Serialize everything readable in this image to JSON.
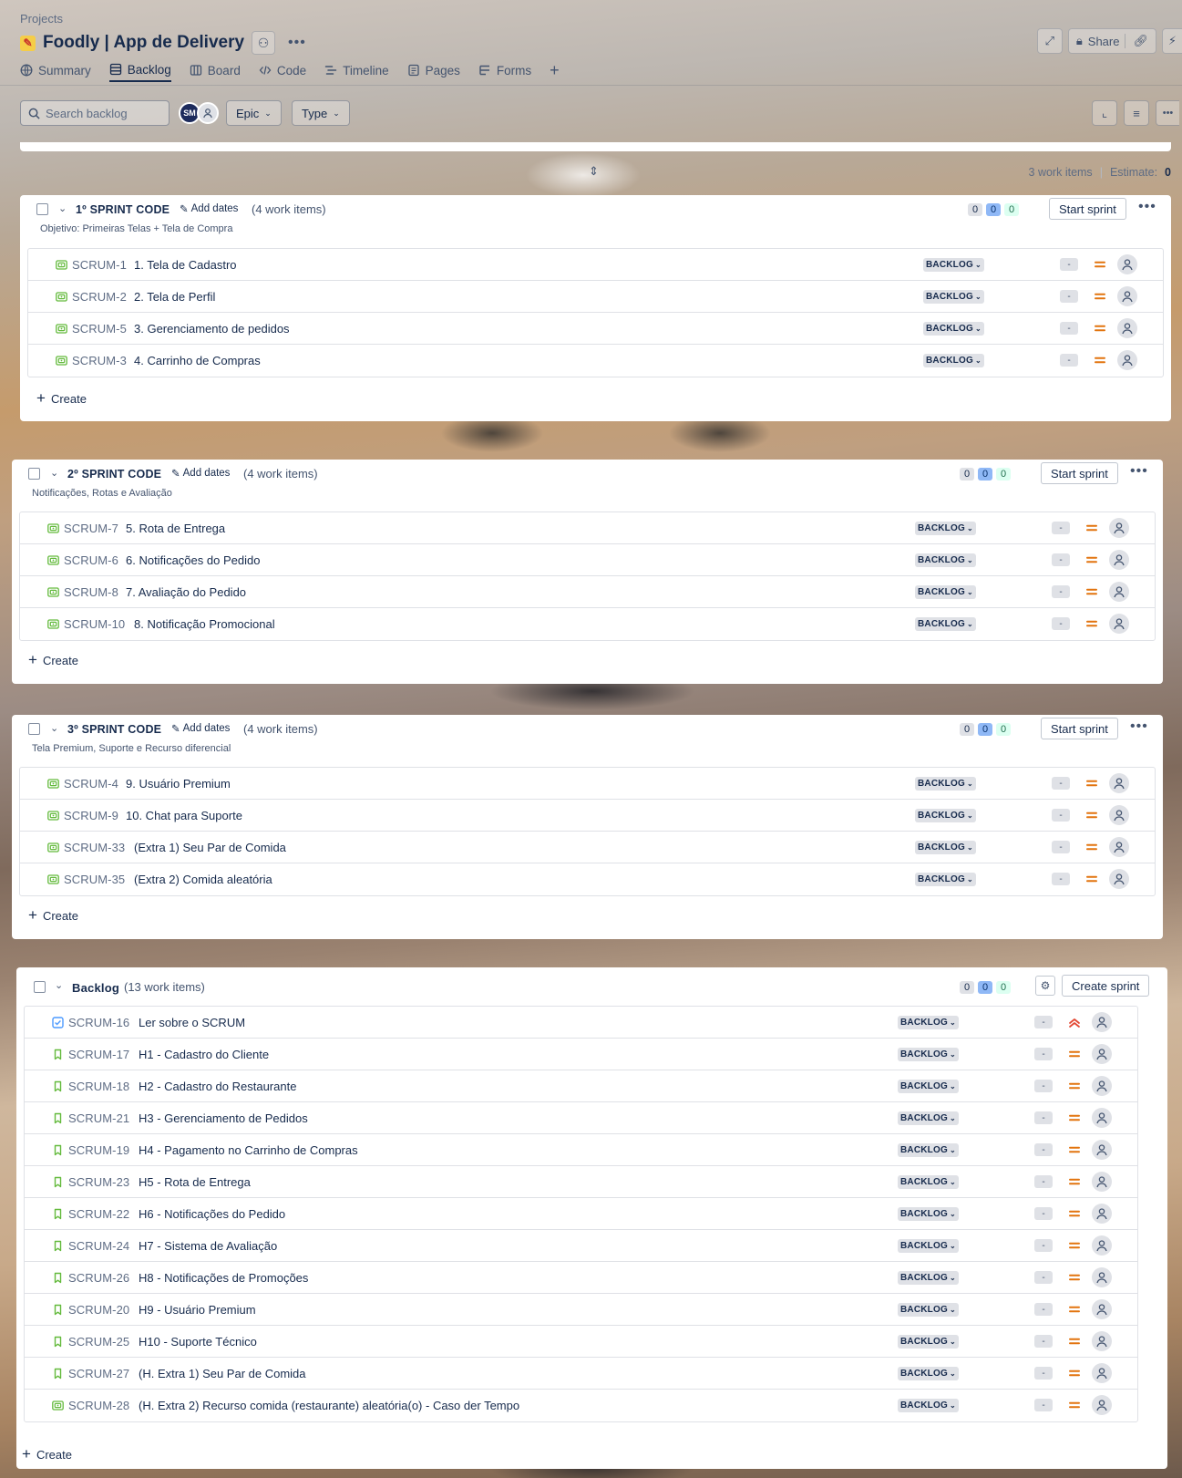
{
  "header": {
    "breadcrumb": "Projects",
    "project_name": "Foodly | App de Delivery",
    "share_label": "Share"
  },
  "tabs": [
    {
      "label": "Summary",
      "icon": "globe-icon"
    },
    {
      "label": "Backlog",
      "icon": "backlog-icon",
      "active": true
    },
    {
      "label": "Board",
      "icon": "board-icon"
    },
    {
      "label": "Code",
      "icon": "code-icon"
    },
    {
      "label": "Timeline",
      "icon": "timeline-icon"
    },
    {
      "label": "Pages",
      "icon": "pages-icon"
    },
    {
      "label": "Forms",
      "icon": "forms-icon"
    }
  ],
  "toolbar": {
    "search_placeholder": "Search backlog",
    "avatar_initials": "SM",
    "epic_label": "Epic",
    "type_label": "Type"
  },
  "top_summary": {
    "work_items": "3 work items",
    "estimate_label": "Estimate:",
    "estimate_value": "0"
  },
  "sprints": [
    {
      "name": "1º SPRINT CODE",
      "add_dates": "Add dates",
      "count_text": "(4 work items)",
      "goal": "Objetivo: Primeiras Telas + Tela de Compra",
      "counts": [
        "0",
        "0",
        "0"
      ],
      "action": "Start sprint",
      "create": "Create",
      "items": [
        {
          "key": "SCRUM-1",
          "summary": "1. Tela de Cadastro",
          "status": "BACKLOG",
          "estimate": "-"
        },
        {
          "key": "SCRUM-2",
          "summary": "2. Tela de Perfil",
          "status": "BACKLOG",
          "estimate": "-"
        },
        {
          "key": "SCRUM-5",
          "summary": "3. Gerenciamento de pedidos",
          "status": "BACKLOG",
          "estimate": "-"
        },
        {
          "key": "SCRUM-3",
          "summary": "4. Carrinho de Compras",
          "status": "BACKLOG",
          "estimate": "-"
        }
      ]
    },
    {
      "name": "2º SPRINT CODE",
      "add_dates": "Add dates",
      "count_text": "(4 work items)",
      "goal": "Notificações, Rotas e Avaliação",
      "counts": [
        "0",
        "0",
        "0"
      ],
      "action": "Start sprint",
      "create": "Create",
      "items": [
        {
          "key": "SCRUM-7",
          "summary": "5. Rota de Entrega",
          "status": "BACKLOG",
          "estimate": "-"
        },
        {
          "key": "SCRUM-6",
          "summary": "6. Notificações do Pedido",
          "status": "BACKLOG",
          "estimate": "-"
        },
        {
          "key": "SCRUM-8",
          "summary": "7. Avaliação do Pedido",
          "status": "BACKLOG",
          "estimate": "-"
        },
        {
          "key": "SCRUM-10",
          "summary": "8. Notificação Promocional",
          "status": "BACKLOG",
          "estimate": "-"
        }
      ]
    },
    {
      "name": "3º SPRINT CODE",
      "add_dates": "Add dates",
      "count_text": "(4 work items)",
      "goal": "Tela Premium, Suporte e Recurso diferencial",
      "counts": [
        "0",
        "0",
        "0"
      ],
      "action": "Start sprint",
      "create": "Create",
      "items": [
        {
          "key": "SCRUM-4",
          "summary": "9. Usuário Premium",
          "status": "BACKLOG",
          "estimate": "-"
        },
        {
          "key": "SCRUM-9",
          "summary": "10. Chat para Suporte",
          "status": "BACKLOG",
          "estimate": "-"
        },
        {
          "key": "SCRUM-33",
          "summary": "(Extra 1) Seu Par de Comida",
          "status": "BACKLOG",
          "estimate": "-"
        },
        {
          "key": "SCRUM-35",
          "summary": "(Extra 2) Comida aleatória",
          "status": "BACKLOG",
          "estimate": "-"
        }
      ]
    }
  ],
  "backlog": {
    "name": "Backlog",
    "count_text": "(13 work items)",
    "counts": [
      "0",
      "0",
      "0"
    ],
    "action": "Create sprint",
    "create": "Create",
    "items": [
      {
        "key": "SCRUM-16",
        "summary": "Ler sobre o SCRUM",
        "status": "BACKLOG",
        "estimate": "-",
        "type": "task",
        "priority": "highest"
      },
      {
        "key": "SCRUM-17",
        "summary": "H1 - Cadastro do Cliente",
        "status": "BACKLOG",
        "estimate": "-",
        "type": "story"
      },
      {
        "key": "SCRUM-18",
        "summary": "H2 - Cadastro do Restaurante",
        "status": "BACKLOG",
        "estimate": "-",
        "type": "story"
      },
      {
        "key": "SCRUM-21",
        "summary": "H3 - Gerenciamento de Pedidos",
        "status": "BACKLOG",
        "estimate": "-",
        "type": "story"
      },
      {
        "key": "SCRUM-19",
        "summary": "H4 - Pagamento no Carrinho de Compras",
        "status": "BACKLOG",
        "estimate": "-",
        "type": "story"
      },
      {
        "key": "SCRUM-23",
        "summary": "H5 - Rota de Entrega",
        "status": "BACKLOG",
        "estimate": "-",
        "type": "story"
      },
      {
        "key": "SCRUM-22",
        "summary": "H6 - Notificações do Pedido",
        "status": "BACKLOG",
        "estimate": "-",
        "type": "story"
      },
      {
        "key": "SCRUM-24",
        "summary": "H7 - Sistema de Avaliação",
        "status": "BACKLOG",
        "estimate": "-",
        "type": "story"
      },
      {
        "key": "SCRUM-26",
        "summary": "H8 - Notificações de Promoções",
        "status": "BACKLOG",
        "estimate": "-",
        "type": "story"
      },
      {
        "key": "SCRUM-20",
        "summary": "H9 - Usuário Premium",
        "status": "BACKLOG",
        "estimate": "-",
        "type": "story"
      },
      {
        "key": "SCRUM-25",
        "summary": "H10 - Suporte Técnico",
        "status": "BACKLOG",
        "estimate": "-",
        "type": "story"
      },
      {
        "key": "SCRUM-27",
        "summary": "(H. Extra 1) Seu Par de Comida",
        "status": "BACKLOG",
        "estimate": "-",
        "type": "story"
      },
      {
        "key": "SCRUM-28",
        "summary": "(H. Extra 2) Recurso comida (restaurante) aleatória(o) - Caso der Tempo",
        "status": "BACKLOG",
        "estimate": "-",
        "type": "epic"
      }
    ]
  },
  "colors": {
    "accent": "#0c66e4",
    "story": "#63ba3c",
    "task": "#4c9aff",
    "priority_medium": "#e2740f",
    "priority_high": "#e34935"
  }
}
